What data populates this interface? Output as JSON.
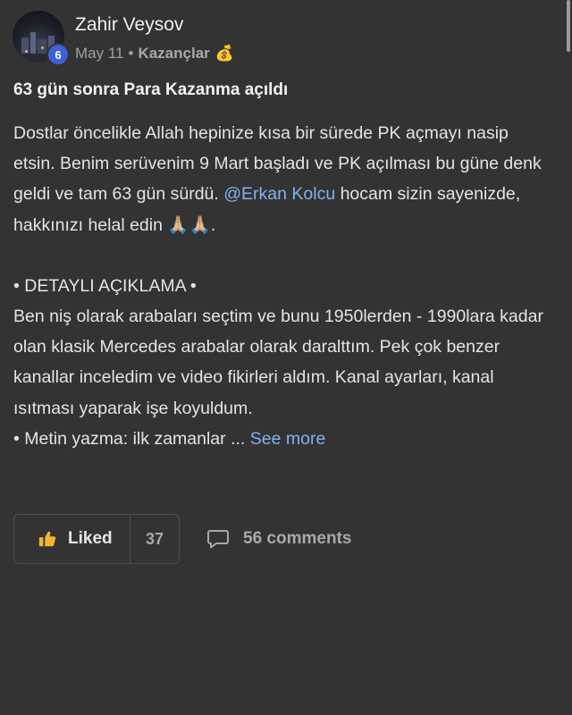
{
  "post": {
    "author": {
      "name": "Zahir Veysov",
      "level": "6"
    },
    "date": "May 11",
    "separator": "•",
    "category": "Kazançlar",
    "category_icon": "money-bag-icon",
    "title": "63 gün sonra Para Kazanma açıldı",
    "body": {
      "p1_before": "Dostlar öncelikle Allah hepinize kısa bir sürede PK açmayı nasip etsin. Benim serüvenim 9 Mart başladı ve PK açılması bu güne denk geldi ve tam 63 gün sürdü. ",
      "mention": "@Erkan Kolcu",
      "p1_after": " hocam sizin sayenizde, hakkınızı helal edin ",
      "emoji": "🙏🏼🙏🏼",
      "p1_end": ".",
      "section_heading": "• DETAYLI AÇIKLAMA •",
      "p2": "Ben niş olarak arabaları seçtim ve bunu 1950lerden - 1990lara kadar olan klasik Mercedes arabalar olarak daralttım. Pek çok benzer kanallar inceledim ve video fikirleri aldım. Kanal ayarları, kanal ısıtması yaparak işe koyuldum.",
      "p3": "• Metin yazma: ilk zamanlar ... ",
      "see_more": "See more"
    }
  },
  "actions": {
    "liked_label": "Liked",
    "like_count": "37",
    "comments_label": "56 comments"
  },
  "colors": {
    "background": "#333334",
    "link": "#7fb2ee",
    "badge": "#3e5fd6",
    "thumb": "#f2b630"
  }
}
